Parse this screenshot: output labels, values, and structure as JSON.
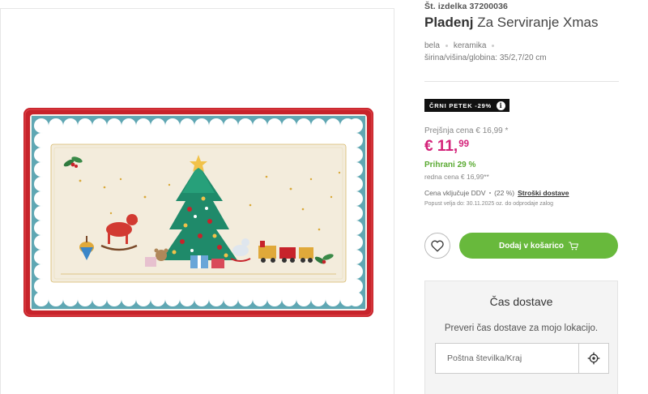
{
  "product": {
    "sku": "Št. izdelka 37200036",
    "brand": "Pladenj",
    "name": " Za Serviranje Xmas",
    "attributes": [
      "bela",
      "keramika"
    ],
    "dimensions": "širina/višina/globina: 35/2,7/20 cm",
    "image_icon": "christmas-tree-serving-platter"
  },
  "promo": {
    "badge": "ČRNI PETEK -29%",
    "info_icon": "i"
  },
  "pricing": {
    "previous": "Prejšnja cena € 16,99 *",
    "price_main": "€ 11,",
    "price_cents": "99",
    "saving": "Prihrani 29 %",
    "regular": "redna cena € 16,99**",
    "vat_text": "Cena vključuje DDV",
    "vat_rate": "(22 %)",
    "shipping_link": "Stroški dostave",
    "validity": "Popust velja do: 30.11.2025 oz. do odprodaje zalog"
  },
  "actions": {
    "wishlist_icon": "heart-icon",
    "add_to_cart": "Dodaj v košarico",
    "cart_icon": "cart-icon"
  },
  "delivery": {
    "title": "Čas dostave",
    "text": "Preveri čas dostave za mojo lokacijo.",
    "placeholder": "Poštna številka/Kraj",
    "locate_icon": "crosshair-icon"
  },
  "colors": {
    "price": "#d4237a",
    "saving": "#5aaa32",
    "cart_button": "#68b93c",
    "badge": "#111111"
  }
}
